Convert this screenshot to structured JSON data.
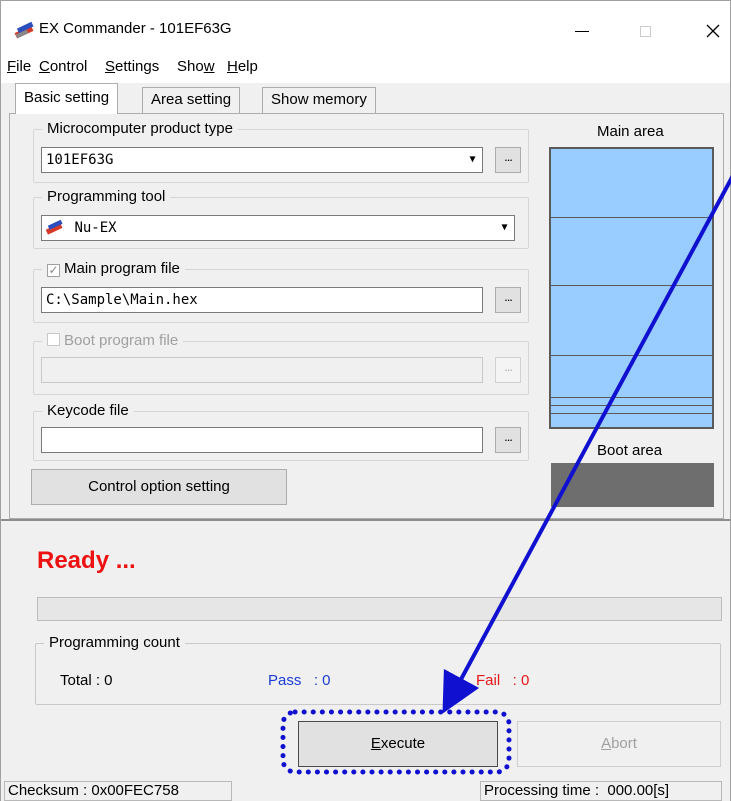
{
  "window": {
    "title": "EX Commander - 101EF63G"
  },
  "menu": [
    {
      "key": "F",
      "rest": "ile"
    },
    {
      "key": "C",
      "rest": "ontrol"
    },
    {
      "key": "S",
      "rest": "ettings"
    },
    {
      "pre": "Sho",
      "key": "w",
      "rest": ""
    },
    {
      "key": "H",
      "rest": "elp"
    }
  ],
  "tabs": [
    "Basic setting",
    "Area setting",
    "Show memory"
  ],
  "basic": {
    "micro_legend": "Microcomputer product type",
    "micro_value": "101EF63G",
    "tool_legend": "Programming tool",
    "tool_value": "Nu-EX",
    "main_file_legend": "Main program file",
    "main_file_value": "C:\\Sample\\Main.hex",
    "boot_file_legend": "Boot program file",
    "boot_file_value": "",
    "keycode_legend": "Keycode file",
    "keycode_value": "",
    "control_option_label": "Control option setting",
    "ellipsis": "..."
  },
  "memory": {
    "main_label": "Main area",
    "boot_label": "Boot area",
    "main_color": "#99ccff",
    "boot_color": "#6e6e6e"
  },
  "status": {
    "text": "Ready ...",
    "color": "#ee1111",
    "progress": 0
  },
  "count": {
    "legend": "Programming count",
    "total": "Total : 0",
    "pass": "Pass   : 0",
    "fail": "Fail   : 0"
  },
  "actions": {
    "execute_key": "E",
    "execute_rest": "xecute",
    "abort_key": "A",
    "abort_rest": "bort"
  },
  "statusbar": {
    "checksum": "Checksum : 0x00FEC758",
    "processing": "Processing time :  000.00[s]"
  },
  "annotation": {
    "arrow_color": "#1010d0",
    "highlight_color": "#1010d0"
  }
}
